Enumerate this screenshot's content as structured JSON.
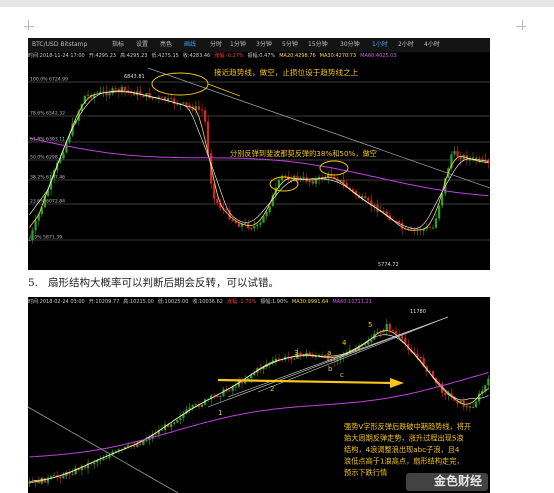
{
  "chart1": {
    "toolbar": {
      "symbol": "BTC/USD Bitstamp",
      "items": [
        "指标",
        "设置",
        "亮色",
        "画线"
      ],
      "periods": [
        "分时",
        "1分钟",
        "3分钟",
        "5分钟",
        "15分钟",
        "30分钟",
        "1小时",
        "2小时",
        "4小时"
      ],
      "active_period": "1小时"
    },
    "ohlc": {
      "time": "时间:2018-11-24 17:00",
      "open": "开:4295.23",
      "high": "高:4295.23",
      "low": "低:4275.15",
      "close": "收:4283.46",
      "change": "涨幅:-0.27%",
      "amp": "振幅:0.47%",
      "ma20": "MA20:4298.76",
      "ma30": "MA30:4270.73",
      "ma60": "MA60:4025.03"
    },
    "high_label": "6843.81",
    "low_label": "5774.72",
    "fib_levels": [
      "100.0% 6724.99",
      "78.6% 6542.32",
      "61.8% 6393.11",
      "50.0% 6298.19",
      "38.2% 6197.46",
      "23.6% 6072.84",
      "0.0% 5871.39"
    ],
    "annotation_top": "接近趋势线，做空，止损位设于趋势线之上",
    "annotation_mid": "分别反弹到斐波那契反弹的38%和50%，做空"
  },
  "caption": {
    "number": "5.",
    "text": "扇形结构大概率可以判断后期会反转，可以试错。"
  },
  "chart2": {
    "ohlc": {
      "time": "时间:2018-02-24 03:00",
      "open": "开:10209.77",
      "high": "高:10215.00",
      "low": "低:10025.00",
      "close": "收:10036.62",
      "change": "涨幅:-1.70%",
      "amp": "振幅:1.90%",
      "ma30": "MA30:9991.64",
      "ma60": "MA60:10711.21"
    },
    "high_label": "11780",
    "wave_labels": [
      "1",
      "2",
      "3",
      "4",
      "5",
      "a",
      "b",
      "c"
    ],
    "annotation": [
      "强势V字形反弹后跌破中期趋势线，将开",
      "始大周期反弹走势，涨升过程出现5浪",
      "结构，4浪调整浪出现abc子浪，且4",
      "浪低点高于1浪高点，扇形结构走完，",
      "预示下跌行情"
    ]
  },
  "watermark": "金色财经",
  "colors": {
    "annotation": "#f5c518",
    "fib_line": "#7a7a7a",
    "ma_purple": "#c040e0",
    "up": "#2ca02c",
    "down": "#d62728"
  }
}
